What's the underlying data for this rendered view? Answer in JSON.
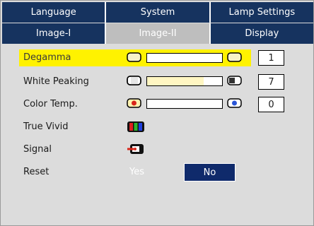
{
  "tabs_row1": [
    {
      "label": "Language"
    },
    {
      "label": "System"
    },
    {
      "label": "Lamp Settings"
    }
  ],
  "tabs_row2": [
    {
      "label": "Image-I"
    },
    {
      "label": "Image-II"
    },
    {
      "label": "Display"
    }
  ],
  "active_tab": "Image-II",
  "settings": {
    "degamma": {
      "label": "Degamma",
      "value": "1",
      "level": 0.0
    },
    "white_peaking": {
      "label": "White Peaking",
      "value": "7",
      "level": 0.75
    },
    "color_temp": {
      "label": "Color Temp.",
      "value": "0",
      "level": 0.0
    },
    "true_vivid": {
      "label": "True Vivid",
      "icon": "rgb-bars-icon"
    },
    "signal": {
      "label": "Signal",
      "icon": "signal-plug-icon"
    },
    "reset": {
      "label": "Reset",
      "yes": "Yes",
      "no": "No",
      "selected": "No"
    }
  },
  "colors": {
    "tab_bg": "#16335f",
    "tab_active_bg": "#bebebe",
    "panel_bg": "#dcdcdc",
    "highlight": "#fff200",
    "no_button_bg": "#0f2a6b"
  }
}
